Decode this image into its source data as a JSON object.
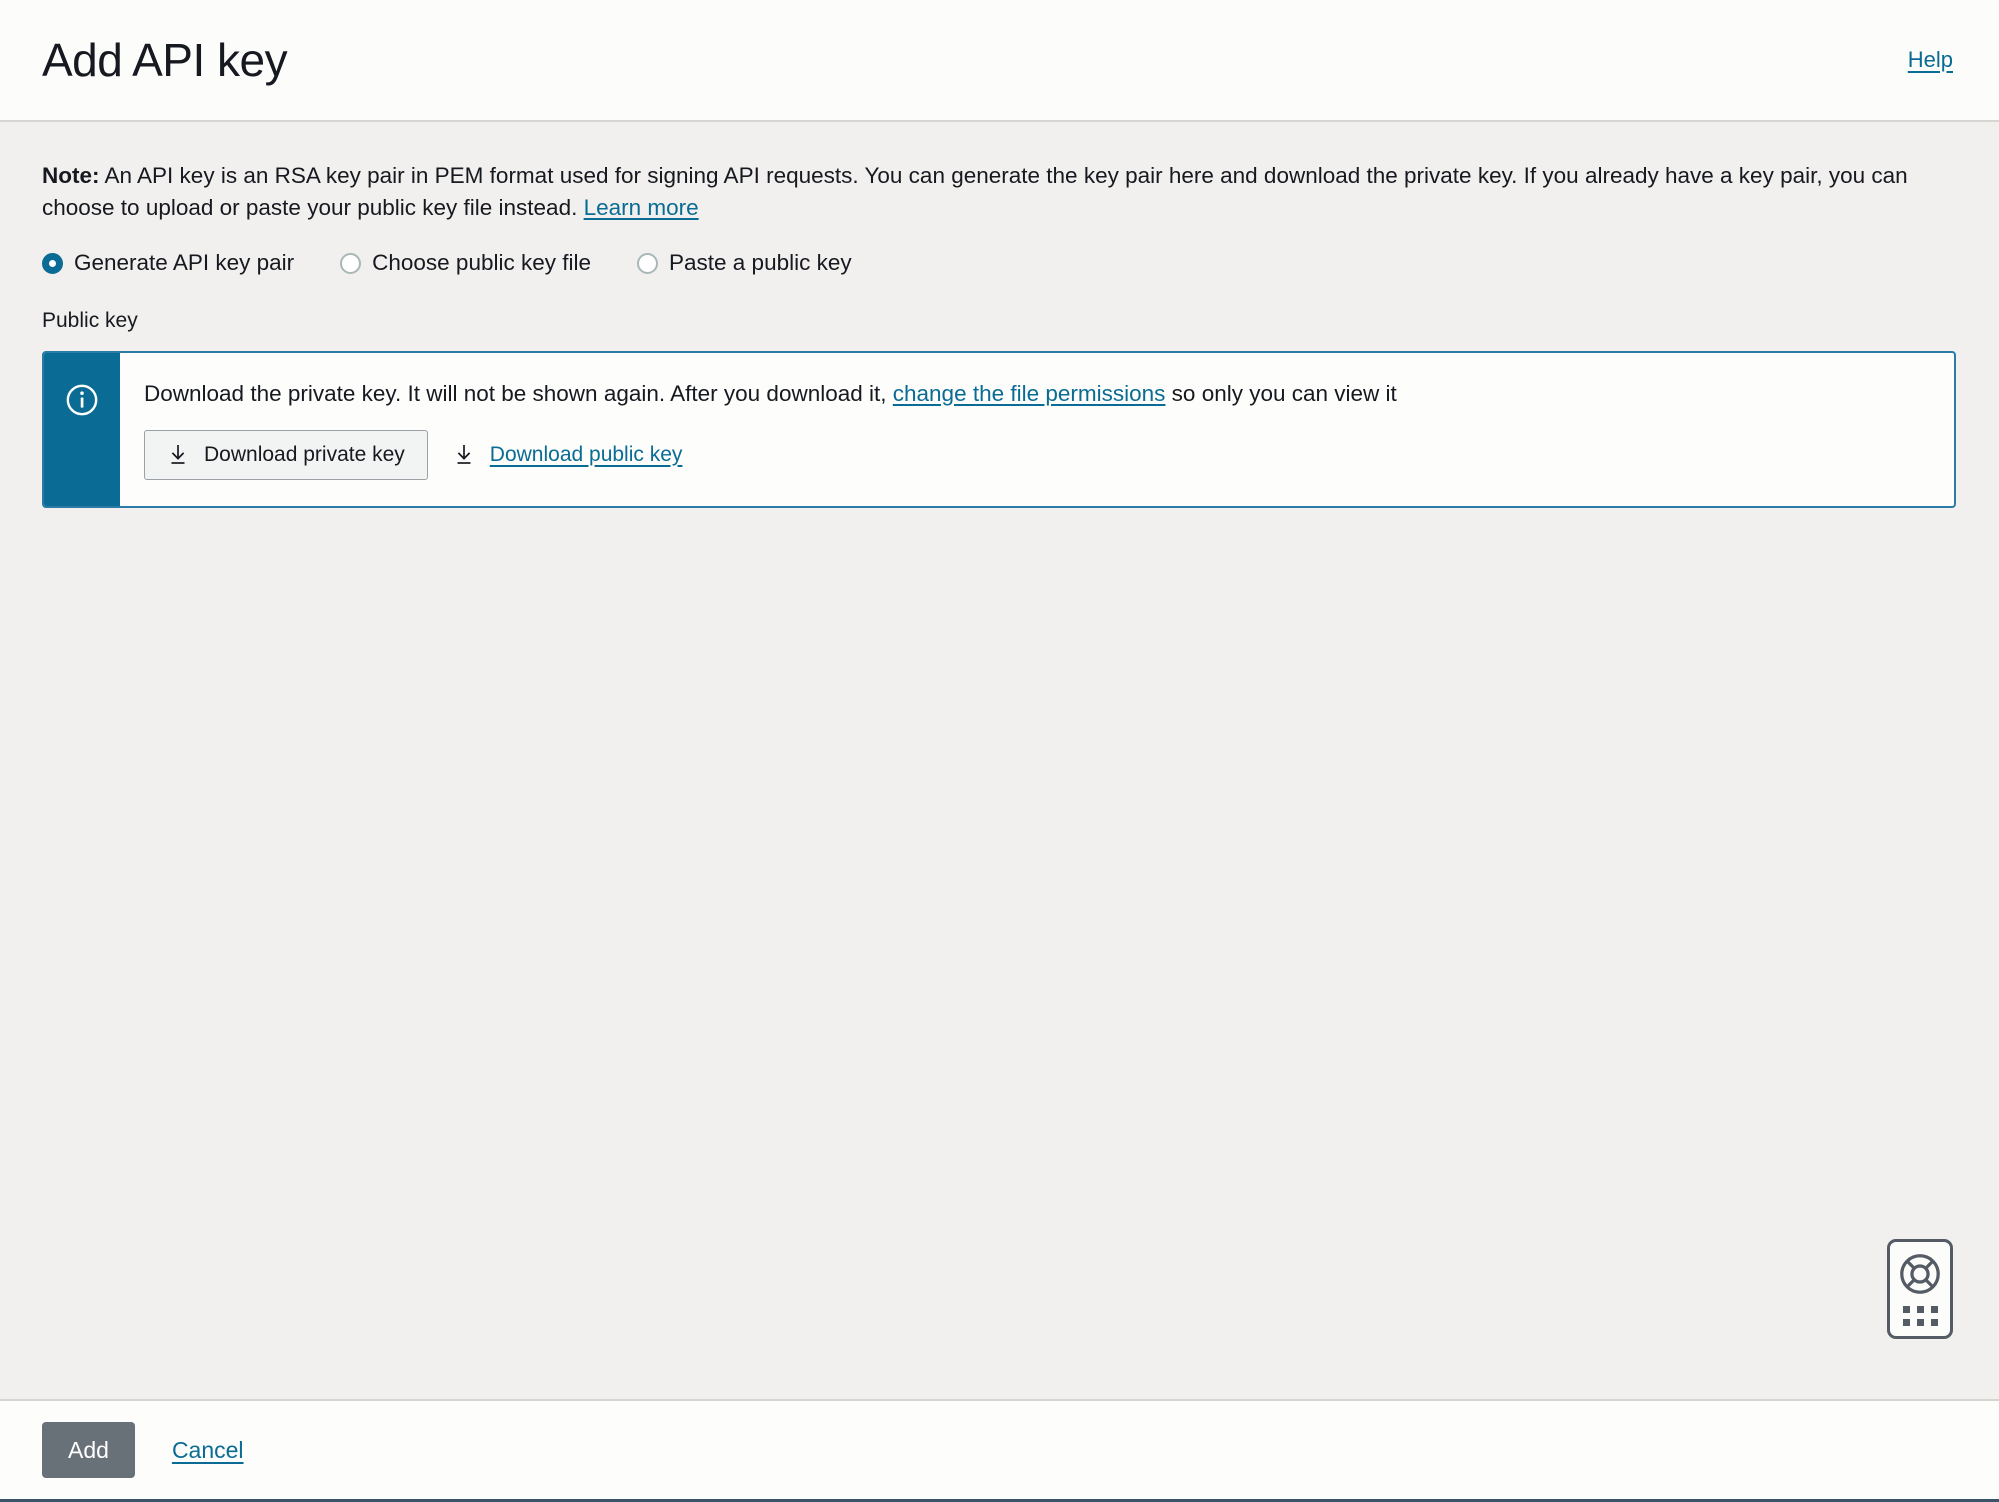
{
  "header": {
    "title": "Add API key",
    "help_label": "Help"
  },
  "note": {
    "bold_prefix": "Note:",
    "text": " An API key is an RSA key pair in PEM format used for signing API requests. You can generate the key pair here and download the private key. If you already have a key pair, you can choose to upload or paste your public key file instead. ",
    "learn_more_label": "Learn more"
  },
  "key_source": {
    "options": [
      {
        "label": "Generate API key pair",
        "selected": true
      },
      {
        "label": "Choose public key file",
        "selected": false
      },
      {
        "label": "Paste a public key",
        "selected": false
      }
    ]
  },
  "public_key": {
    "label": "Public key"
  },
  "alert": {
    "icon": "info-icon",
    "text_before_link": "Download the private key. It will not be shown again. After you download it, ",
    "link_label": "change the file permissions",
    "text_after_link": " so only you can view it",
    "download_private_label": "Download private key",
    "download_public_label": "Download public key",
    "download_icon": "download-icon"
  },
  "help_widget": {
    "icon": "life-ring-icon",
    "handle": "drag-handle-dots"
  },
  "footer": {
    "add_label": "Add",
    "cancel_label": "Cancel"
  },
  "colors": {
    "accent_teal": "#0a6c94",
    "link": "#0a6c94",
    "alert_border": "#2a7ba8",
    "body_bg": "#f1f0ee",
    "header_bg": "#fcfcfb",
    "disabled_button": "#687078",
    "bottom_rule": "#3b5368"
  }
}
